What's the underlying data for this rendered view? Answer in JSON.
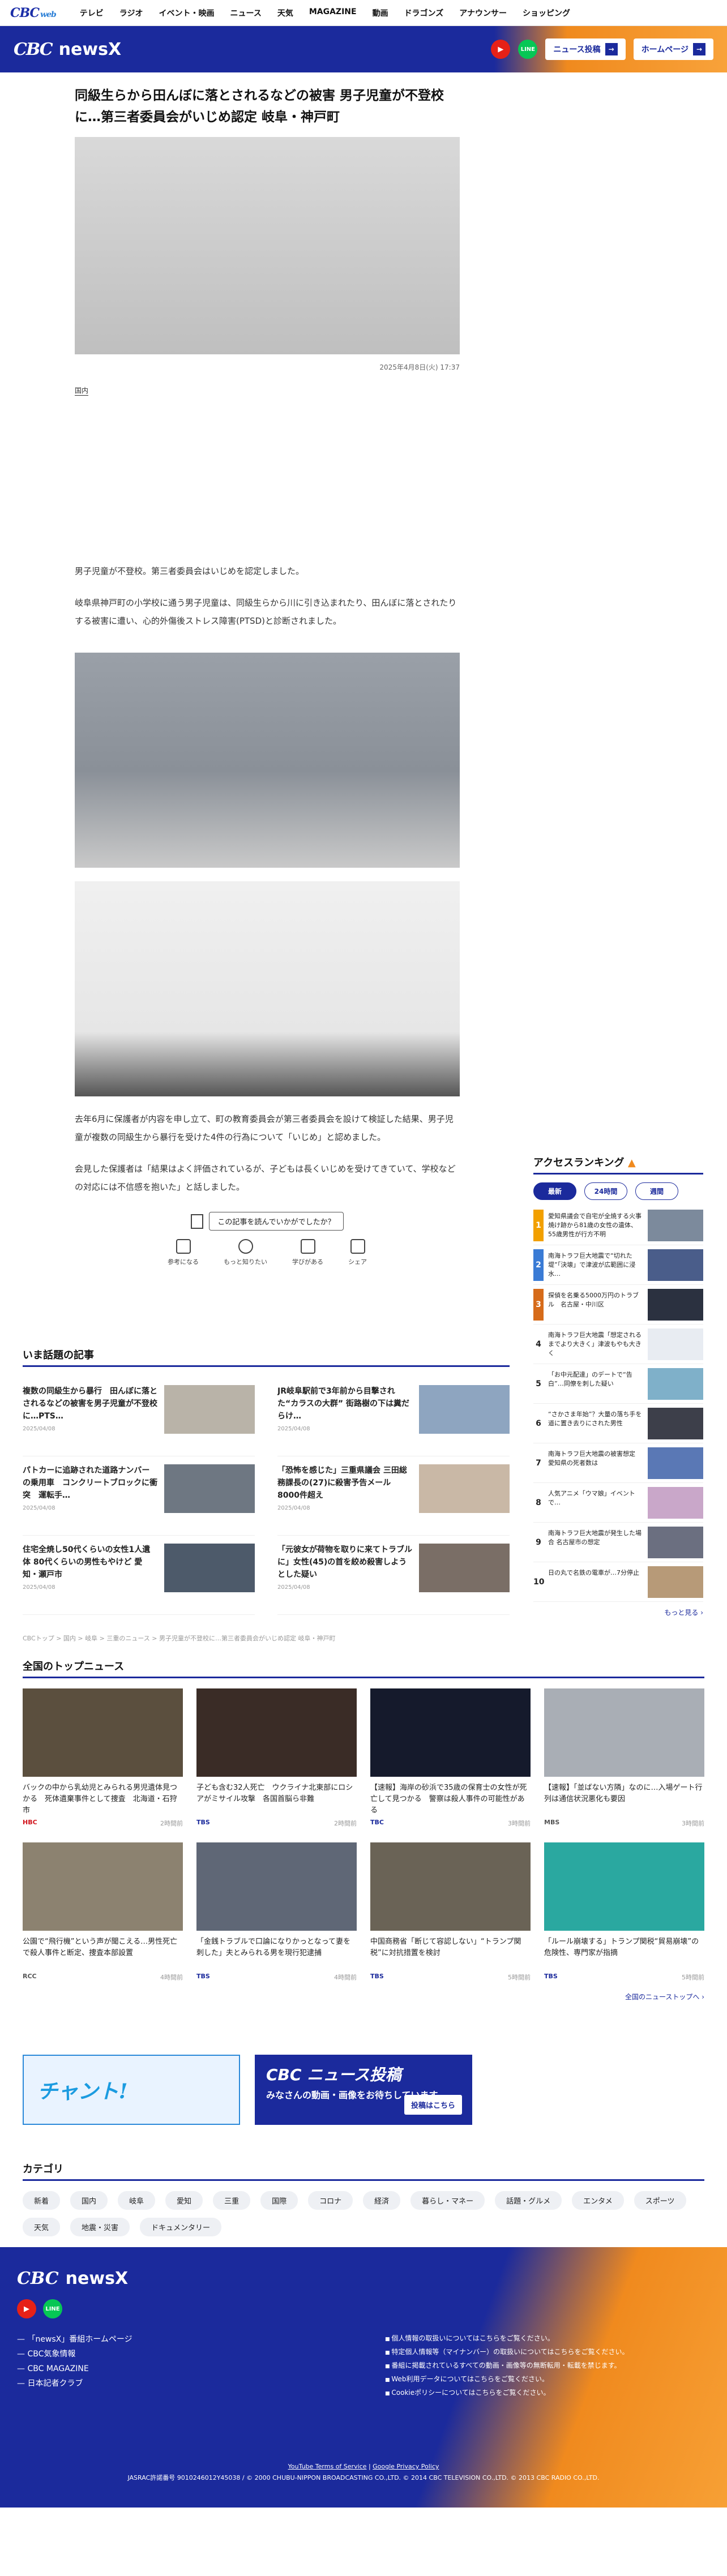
{
  "topnav": {
    "logo": "CBC",
    "logo_sub": "web",
    "items": [
      "テレビ",
      "ラジオ",
      "イベント・映画",
      "ニュース",
      "天気",
      "MAGAZINE",
      "動画",
      "ドラゴンズ",
      "アナウンサー",
      "ショッピング"
    ]
  },
  "header": {
    "logo_c": "CBC",
    "logo_text": "newsX",
    "youtube": "▶",
    "line": "LINE",
    "post_button": "ニュース投稿",
    "home_button": "ホームページ"
  },
  "article": {
    "title": "同級生らから田んぼに落とされるなどの被害 男子児童が不登校に…第三者委員会がいじめ認定 岐阜・神戸町",
    "date": "2025年4月8日(火) 17:37",
    "tag": "国内",
    "p1": "男子児童が不登校。第三者委員会はいじめを認定しました。",
    "p2": "岐阜県神戸町の小学校に通う男子児童は、同級生らから川に引き込まれたり、田んぼに落とされたりする被害に遭い、心的外傷後ストレス障害(PTSD)と診断されました。",
    "p3": "去年6月に保護者が内容を申し立て、町の教育委員会が第三者委員会を設けて検証した結果、男子児童が複数の同級生から暴行を受けた4件の行為について「いじめ」と認めました。",
    "p4": "会見した保護者は「結果はよく評価されているが、子どもは長くいじめを受けてきていて、学校などの対応には不信感を抱いた」と話しました。",
    "feedback_q": "この記事を読んでいかがでしたか？",
    "feedback": [
      "参考になる",
      "もっと知りたい",
      "学びがある",
      "シェア"
    ]
  },
  "ranking": {
    "title": "アクセスランキング",
    "tabs": [
      "最新",
      "24時間",
      "週間"
    ],
    "items": [
      "愛知県議会で自宅が全焼する火事　焼け跡から81歳の女性の遺体、55歳男性が行方不明",
      "南海トラフ巨大地震で“切れた堤”「決壊」で津波が広範囲に浸水…",
      "探偵を名乗る5000万円のトラブル　名古屋・中川区",
      "南海トラフ巨大地震「想定されるまでより大きく」津波もやも大きく",
      "「お中元配達」のデートで“告白”…同僚を刺した疑い",
      "“さかさま年始”？大量の落ち手を道に置き去りにされた男性",
      "南海トラフ巨大地震の被害想定 愛知県の死者数は",
      "人気アニメ「ウマ娘」イベントで…",
      "南海トラフ巨大地震が発生した場合 名古屋市の想定",
      "日の丸で名鉄の電車が…7分停止"
    ],
    "more": "もっと見る"
  },
  "trending": {
    "title": "いま話題の記事",
    "items": [
      {
        "title": "複数の同級生から暴行　田んぼに落とされるなどの被害を男子児童が不登校に…PTS…",
        "date": "2025/04/08"
      },
      {
        "title": "JR岐阜駅前で3年前から目撃された“カラスの大群” 街路樹の下は糞だらけ…",
        "date": "2025/04/08"
      },
      {
        "title": "パトカーに追跡された道路ナンバーの乗用車　コンクリートブロックに衝突　運転手…",
        "date": "2025/04/08"
      },
      {
        "title": "「恐怖を感じた」三重県議会 三田総務課長の(27)に殺害予告メール 8000件超え",
        "date": "2025/04/08"
      },
      {
        "title": "住宅全焼し50代くらいの女性1人遺体 80代くらいの男性もやけど 愛知・瀬戸市",
        "date": "2025/04/08"
      },
      {
        "title": "「元彼女が荷物を取りに来てトラブルに」女性(45)の首を絞め殺害しようとした疑い",
        "date": "2025/04/08"
      }
    ]
  },
  "breadcrumb": "CBCトップ > 国内 > 岐阜 > 三重のニュース > 男子児童が不登校に…第三者委員会がいじめ認定 岐阜・神戸町",
  "national": {
    "title": "全国のトップニュース",
    "items": [
      {
        "title": "バックの中から乳幼児とみられる男児遺体見つかる　死体遺棄事件として捜査　北海道・石狩市",
        "src": "HBC",
        "date": "2時間前"
      },
      {
        "title": "子ども含む32人死亡　ウクライナ北東部にロシアがミサイル攻撃　各国首脳ら非難",
        "src": "TBS",
        "date": "2時間前"
      },
      {
        "title": "【速報】海岸の砂浜で35歳の保育士の女性が死亡して見つかる　警察は殺人事件の可能性がある",
        "src": "TBC",
        "date": "3時間前"
      },
      {
        "title": "【速報】「並ばない方隣」なのに…入場ゲート行列は通信状況悪化も要因",
        "src": "MBS",
        "date": "3時間前"
      },
      {
        "title": "公園で“飛行機”という声が聞こえる…男性死亡で殺人事件と断定、捜査本部設置",
        "src": "RCC",
        "date": "4時間前"
      },
      {
        "title": "「金銭トラブルで口論になりかっとなって妻を刺した」夫とみられる男を現行犯逮捕",
        "src": "TBS",
        "date": "4時間前"
      },
      {
        "title": "中国商務省「断じて容認しない」“トランプ関税”に対抗措置を検討",
        "src": "TBS",
        "date": "5時間前"
      },
      {
        "title": "「ルール崩壊する」トランプ関税“貿易崩壊”の危険性、専門家が指摘",
        "src": "TBS",
        "date": "5時間前"
      }
    ],
    "more": "全国のニューストップへ"
  },
  "banners": {
    "b1": "チャント!",
    "b2_title": "CBC ニュース投稿",
    "b2_text": "みなさんの動画・画像をお待ちしています。",
    "b2_btn": "投稿はこちら"
  },
  "categories": {
    "title": "カテゴリ",
    "items": [
      "新着",
      "国内",
      "岐阜",
      "愛知",
      "三重",
      "国際",
      "コロナ",
      "経済",
      "暮らし・マネー",
      "話題・グルメ",
      "エンタメ",
      "スポーツ",
      "天気",
      "地震・災害",
      "ドキュメンタリー"
    ]
  },
  "footer": {
    "logo_c": "CBC",
    "logo_text": "newsX",
    "links": [
      "「newsX」番組ホームページ",
      "CBC気象情報",
      "CBC MAGAZINE",
      "日本記者クラブ"
    ],
    "privacy": [
      "個人情報の取扱いについてはこちらをご覧ください。",
      "特定個人情報等（マイナンバー）の取扱いについてはこちらをご覧ください。",
      "番組に掲載されているすべての動画・画像等の無断転用・転載を禁じます。",
      "Web利用データについてはこちらをご覧ください。",
      "Cookieポリシーについてはこちらをご覧ください。"
    ],
    "yt_terms": "YouTube Terms of Service",
    "google_priv": "Google Privacy Policy",
    "copyright": "JASRAC許諾番号 9010246012Y45038 / © 2000 CHUBU-NIPPON BROADCASTING CO.,LTD. © 2014 CBC TELEVISION CO.,LTD. © 2013 CBC RADIO CO.,LTD."
  }
}
